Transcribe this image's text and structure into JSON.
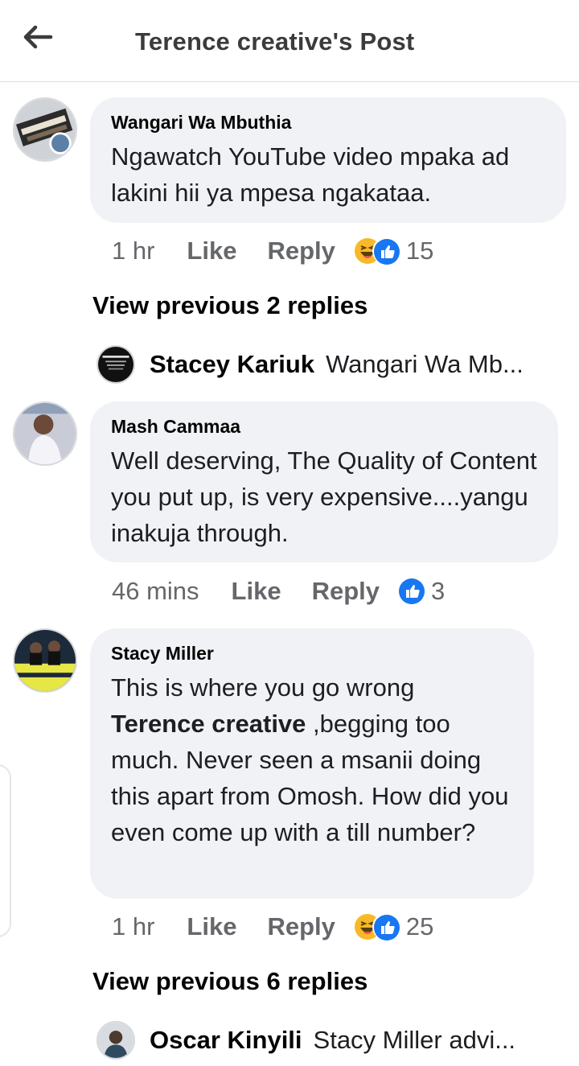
{
  "header": {
    "title": "Terence creative's Post",
    "back_icon": "arrow-left-icon"
  },
  "comments": [
    {
      "author": "Wangari Wa Mbuthia",
      "text": "Ngawatch YouTube video mpaka ad lakini hii ya mpesa ngakataa.",
      "time": "1 hr",
      "like_label": "Like",
      "reply_label": "Reply",
      "reactions": [
        "haha-icon",
        "like-icon"
      ],
      "reaction_count": "15",
      "view_previous": "View previous 2 replies",
      "latest_reply": {
        "author": "Stacey Kariuk",
        "snippet": "Wangari Wa Mb..."
      }
    },
    {
      "author": "Mash Cammaa",
      "text": "Well deserving, The Quality of Content you put up, is very expensive....yangu inakuja through.",
      "time": "46 mins",
      "like_label": "Like",
      "reply_label": "Reply",
      "reactions": [
        "like-icon"
      ],
      "reaction_count": "3"
    },
    {
      "author": "Stacy Miller",
      "text_mention": "Terence creative",
      "text_before": "This is where you go wrong ",
      "text_after": " ,begging too much. Never seen a msanii doing this apart from Omosh. How did you even come up with a till number?",
      "time": "1 hr",
      "like_label": "Like",
      "reply_label": "Reply",
      "reactions": [
        "haha-icon",
        "like-icon"
      ],
      "reaction_count": "25",
      "view_previous": "View previous 6 replies",
      "latest_reply": {
        "author": "Oscar Kinyili",
        "snippet": "Stacy Miller advi..."
      }
    }
  ],
  "colors": {
    "bubble": "#f0f2f5",
    "meta_text": "#65676b",
    "like_blue": "#1877f2",
    "haha_yellow": "#f7b928"
  }
}
